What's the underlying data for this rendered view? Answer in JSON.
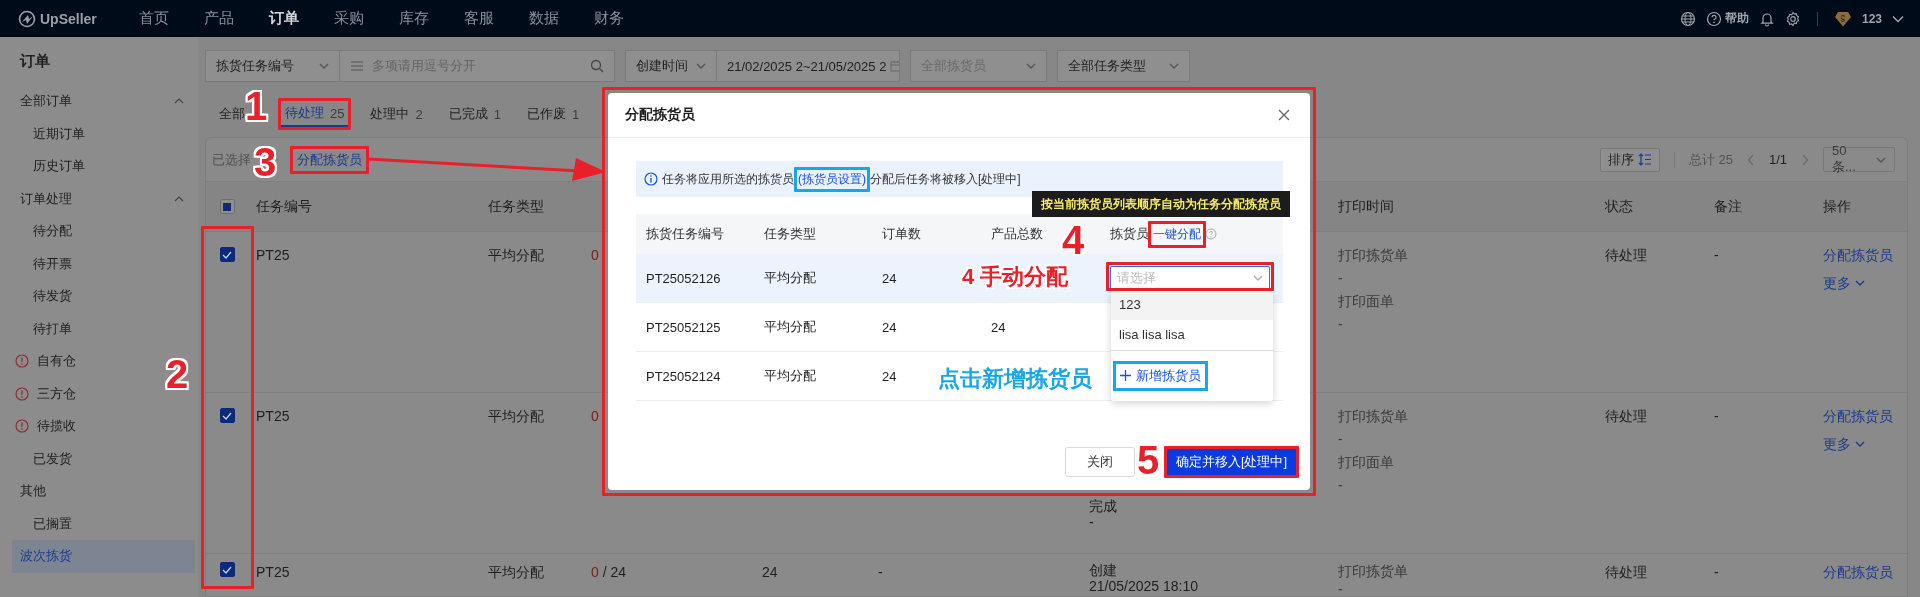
{
  "topbar": {
    "logo": "UpSeller",
    "nav": [
      {
        "label": "首页",
        "selected": false
      },
      {
        "label": "产品",
        "selected": false
      },
      {
        "label": "订单",
        "selected": true
      },
      {
        "label": "采购",
        "selected": false
      },
      {
        "label": "库存",
        "selected": false
      },
      {
        "label": "客服",
        "selected": false
      },
      {
        "label": "数据",
        "selected": false
      },
      {
        "label": "财务",
        "selected": false
      }
    ],
    "help": "帮助",
    "account": "123"
  },
  "sidebar": {
    "title": "订单",
    "items": [
      {
        "label": "全部订单",
        "selected": false,
        "expanded": true,
        "children": [
          {
            "label": "近期订单",
            "selected": false
          },
          {
            "label": "历史订单",
            "selected": false
          }
        ]
      },
      {
        "label": "订单处理",
        "selected": false,
        "expanded": true,
        "children": [
          {
            "label": "待分配",
            "selected": false
          },
          {
            "label": "待开票",
            "selected": false
          },
          {
            "label": "待发货",
            "selected": false
          },
          {
            "label": "待打单",
            "selected": false
          },
          {
            "label": "自有仓",
            "selected": false,
            "alert": true
          },
          {
            "label": "三方仓",
            "selected": false,
            "alert": true
          },
          {
            "label": "待揽收",
            "selected": false,
            "alert": true
          },
          {
            "label": "已发货",
            "selected": false
          }
        ]
      },
      {
        "label": "其他",
        "selected": false,
        "children": [
          {
            "label": "已搁置",
            "selected": false
          }
        ]
      },
      {
        "label": "波次拣货",
        "selected": true
      }
    ]
  },
  "filters": {
    "field_select": "拣货任务编号",
    "search": {
      "placeholder": "多项请用逗号分开"
    },
    "time_select": "创建时间",
    "date_range": "21/02/2025 2~21/05/2025 2",
    "picker_select": {
      "placeholder": "全部拣货员"
    },
    "type_select": "全部任务类型"
  },
  "tabs": [
    {
      "label": "全部",
      "selected": false
    },
    {
      "label": "待处理",
      "count": "25",
      "selected": true
    },
    {
      "label": "处理中",
      "count": "2",
      "selected": false
    },
    {
      "label": "已完成",
      "count": "1",
      "selected": false
    },
    {
      "label": "已作废",
      "count": "1",
      "selected": false
    }
  ],
  "toolbar": {
    "selected_label": "已选择",
    "assign": "分配拣货员",
    "sort": "排序",
    "total": "总计 25",
    "page": "1/1",
    "page_size": "50条..."
  },
  "table": {
    "select_all": {
      "checked": false,
      "partial": true
    },
    "columns": {
      "id": "任务编号",
      "type": "任务类型",
      "print_time": "打印时间",
      "status": "状态",
      "remark": "备注",
      "actions": "操作"
    },
    "rows": [
      {
        "checked": true,
        "id": "PT25",
        "type": "平均分配",
        "picked": "0",
        "print": [
          "打印拣货单",
          "-",
          "打印面单",
          "-"
        ],
        "status": "待处理",
        "remark": "-",
        "actions": [
          "分配拣货员",
          "更多"
        ]
      },
      {
        "checked": true,
        "id": "PT25",
        "type": "平均分配",
        "picked": "0",
        "created": {
          "lines": [
            "完成",
            "-"
          ],
          "clipped": true
        },
        "print": [
          "打印拣货单",
          "-",
          "打印面单",
          "-"
        ],
        "status": "待处理",
        "remark": "-",
        "actions": [
          "分配拣货员",
          "更多"
        ]
      },
      {
        "checked": true,
        "id": "PT25",
        "type": "平均分配",
        "picked": "0",
        "total": "/ 24",
        "orders": "24",
        "products": "-",
        "created": {
          "lines": [
            "创建",
            "21/05/2025 18:10"
          ],
          "clipped": false
        },
        "print": [
          "打印拣货单",
          "-"
        ],
        "status": "待处理",
        "remark": "-",
        "actions": [
          "分配拣货员"
        ]
      }
    ]
  },
  "modal": {
    "title": "分配拣货员",
    "notice": {
      "before": "任务将应用所选的拣货员",
      "link": "(拣货员设置)",
      "after": "分配后任务将被移入[处理中]"
    },
    "columns": [
      "拣货任务编号",
      "任务类型",
      "订单数",
      "产品总数",
      "拣货员"
    ],
    "auto_assign": "一键分配",
    "tooltip": "按当前拣货员列表顺序自动为任务分配拣货员",
    "rows": [
      {
        "id": "PT25052126",
        "type": "平均分配",
        "orders": "24",
        "hovered": true,
        "picker": {
          "placeholder": "请选择"
        }
      },
      {
        "id": "PT25052125",
        "type": "平均分配",
        "orders": "24",
        "products": "24",
        "hovered": false
      },
      {
        "id": "PT25052124",
        "type": "平均分配",
        "orders": "24",
        "hovered": false
      }
    ],
    "dropdown": {
      "options": [
        {
          "label": "123",
          "hovered": true
        },
        {
          "label": "lisa lisa lisa",
          "hovered": false
        }
      ],
      "add": "新增拣货员"
    },
    "buttons": {
      "close": "关闭",
      "confirm": "确定并移入[处理中]"
    }
  },
  "annotations": [
    {
      "kind": "box",
      "color": "#e8202a"
    },
    {
      "kind": "number",
      "text": "1",
      "color": "#e8202a"
    },
    {
      "kind": "box",
      "color": "#e8202a"
    },
    {
      "kind": "number",
      "text": "3",
      "color": "#e8202a"
    },
    {
      "kind": "arrow",
      "color": "#e8202a"
    },
    {
      "kind": "box",
      "color": "#e8202a"
    },
    {
      "kind": "number",
      "text": "2",
      "color": "#e8202a"
    },
    {
      "kind": "box",
      "color": "#e8202a"
    },
    {
      "kind": "box",
      "color": "#18a6e6"
    },
    {
      "kind": "number",
      "text": "4",
      "color": "#e8202a"
    },
    {
      "kind": "box",
      "color": "#e8202a"
    },
    {
      "kind": "label",
      "text": "4 手动分配",
      "color": "#e8202a"
    },
    {
      "kind": "box",
      "color": "#e8202a"
    },
    {
      "kind": "label",
      "text": "点击新增拣货员",
      "color": "#18a6e6"
    },
    {
      "kind": "box",
      "color": "#18a6e6"
    },
    {
      "kind": "number",
      "text": "5",
      "color": "#e8202a"
    },
    {
      "kind": "box",
      "color": "#e8202a"
    }
  ]
}
